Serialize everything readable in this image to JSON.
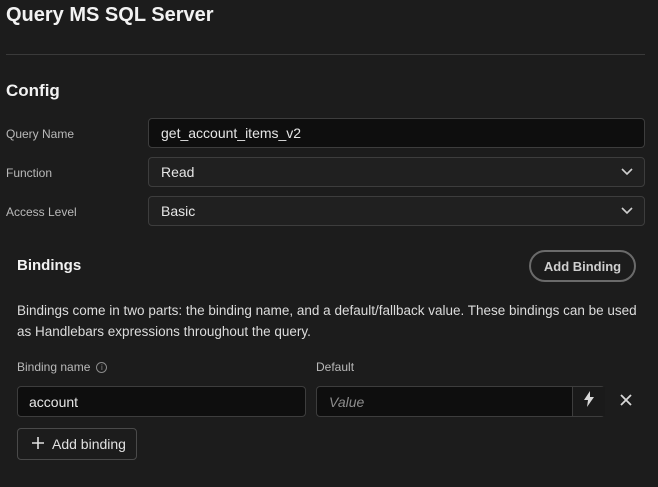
{
  "header": {
    "title": "Query MS SQL Server"
  },
  "config": {
    "section_title": "Config",
    "query_name": {
      "label": "Query Name",
      "value": "get_account_items_v2"
    },
    "function": {
      "label": "Function",
      "value": "Read"
    },
    "access_level": {
      "label": "Access Level",
      "value": "Basic"
    }
  },
  "bindings": {
    "title": "Bindings",
    "add_button": "Add Binding",
    "description": "Bindings come in two parts: the binding name, and a default/fallback value. These bindings can be used as Handlebars expressions throughout the query.",
    "col_name": "Binding name",
    "col_default": "Default",
    "rows": [
      {
        "name": "account",
        "default_placeholder": "Value"
      }
    ],
    "add_small": "Add binding"
  },
  "icons": {
    "select": "chevron-down-icon",
    "info": "info-icon",
    "bolt": "lightning-icon",
    "remove": "close-icon",
    "plus": "plus-icon"
  }
}
